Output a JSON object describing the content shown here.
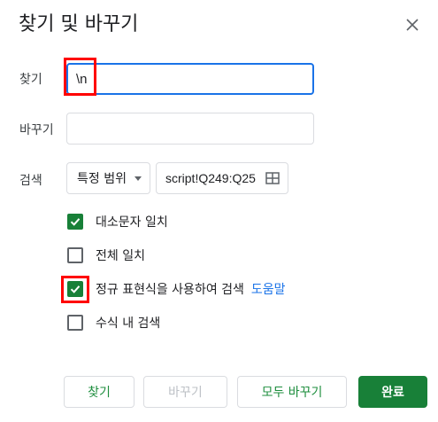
{
  "dialog": {
    "title": "찾기 및 바꾸기",
    "close_icon": "close-icon"
  },
  "find": {
    "label": "찾기",
    "value": "\\n"
  },
  "replace": {
    "label": "바꾸기",
    "value": ""
  },
  "search": {
    "label": "검색",
    "scope_selected": "특정 범위",
    "range_value": "script!Q249:Q25",
    "range_icon": "grid-select-icon"
  },
  "options": {
    "match_case": {
      "label": "대소문자 일치",
      "checked": true
    },
    "match_entire": {
      "label": "전체 일치",
      "checked": false
    },
    "regex": {
      "label": "정규 표현식을 사용하여 검색",
      "checked": true,
      "help_label": "도움말"
    },
    "formulas": {
      "label": "수식 내 검색",
      "checked": false
    }
  },
  "buttons": {
    "find": "찾기",
    "replace": "바꾸기",
    "replace_all": "모두 바꾸기",
    "done": "완료"
  },
  "colors": {
    "accent_green": "#188038",
    "focus_blue": "#1a73e8",
    "highlight_red": "#ff0000"
  }
}
